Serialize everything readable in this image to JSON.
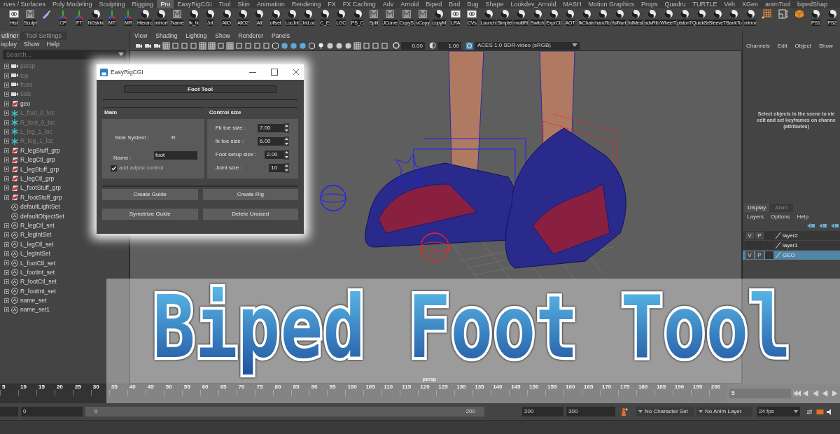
{
  "shelf_tabs": [
    {
      "label": "rves / Surfaces",
      "selected": false
    },
    {
      "label": "Poly Modeling",
      "selected": false
    },
    {
      "label": "Sculpting",
      "selected": false
    },
    {
      "label": "Rigging",
      "selected": false
    },
    {
      "label": "Pro",
      "selected": true
    },
    {
      "label": "EasyRigCGI",
      "selected": false
    },
    {
      "label": "Tool",
      "selected": false
    },
    {
      "label": "Skin",
      "selected": false
    },
    {
      "label": "Animation",
      "selected": false
    },
    {
      "label": "Rendering",
      "selected": false
    },
    {
      "label": "FX",
      "selected": false
    },
    {
      "label": "FX Caching",
      "selected": false
    },
    {
      "label": "Adv",
      "selected": false
    },
    {
      "label": "Arnold",
      "selected": false
    },
    {
      "label": "Biped",
      "selected": false
    },
    {
      "label": "Bird",
      "selected": false
    },
    {
      "label": "Bug",
      "selected": false
    },
    {
      "label": "Shape",
      "selected": false
    },
    {
      "label": "Lookdev_Arnold",
      "selected": false
    },
    {
      "label": "MASH",
      "selected": false
    },
    {
      "label": "Motion Graphics",
      "selected": false
    },
    {
      "label": "Props",
      "selected": false
    },
    {
      "label": "Quadru",
      "selected": false
    },
    {
      "label": "TURTLE",
      "selected": false
    },
    {
      "label": "Veh",
      "selected": false
    },
    {
      "label": "XGen",
      "selected": false
    },
    {
      "label": "animTool",
      "selected": false
    },
    {
      "label": "bipedShap",
      "selected": false
    }
  ],
  "shelf_items": [
    {
      "label": "Hist",
      "kind": "image"
    },
    {
      "label": "Sculpt",
      "kind": "tile"
    },
    {
      "kind": "brush"
    },
    {
      "label": "CP",
      "kind": "axes"
    },
    {
      "label": "FT",
      "kind": "axes"
    },
    {
      "label": "NGskin",
      "kind": "script"
    },
    {
      "label": "MT",
      "kind": "axes"
    },
    {
      "label": "MR",
      "kind": "axes"
    },
    {
      "label": "Hierarc",
      "kind": "script"
    },
    {
      "label": "mirrorI",
      "kind": "script"
    },
    {
      "label": "Name",
      "kind": "tile"
    },
    {
      "label": "fk_Ik",
      "kind": "script"
    },
    {
      "label": "Jnt",
      "kind": "script"
    },
    {
      "label": "AllO",
      "kind": "script"
    },
    {
      "label": "AllO2",
      "kind": "script"
    },
    {
      "label": "All",
      "kind": "script"
    },
    {
      "label": "offset",
      "kind": "script"
    },
    {
      "label": "LocJnt",
      "kind": "script"
    },
    {
      "label": "JntLoc",
      "kind": "script"
    },
    {
      "label": "C_E",
      "kind": "script"
    },
    {
      "label": "LOC",
      "kind": "script"
    },
    {
      "label": "PS_C",
      "kind": "script"
    },
    {
      "label": "Split",
      "kind": "tile"
    },
    {
      "label": "JCurve",
      "kind": "tile"
    },
    {
      "label": "CopyS",
      "kind": "tile"
    },
    {
      "label": "vCopy",
      "kind": "tile"
    },
    {
      "label": "copyM",
      "kind": "script"
    },
    {
      "label": "LRA",
      "kind": "image"
    },
    {
      "label": "CVs",
      "kind": "image"
    },
    {
      "label": "Launch",
      "kind": "script"
    },
    {
      "label": "Simplel",
      "kind": "script"
    },
    {
      "label": "multiRi",
      "kind": "script"
    },
    {
      "label": "Switch",
      "kind": "script"
    },
    {
      "label": "ExprCtl",
      "kind": "script"
    },
    {
      "label": "AOT",
      "kind": "script"
    },
    {
      "label": "fkChain",
      "kind": "script"
    },
    {
      "label": "handTo",
      "kind": "script"
    },
    {
      "label": "folNurt",
      "kind": "script"
    },
    {
      "label": "folMesl",
      "kind": "script"
    },
    {
      "label": "advRib",
      "kind": "script"
    },
    {
      "label": "WheelT",
      "kind": "script"
    },
    {
      "label": "pistonT",
      "kind": "script"
    },
    {
      "label": "QuickSe",
      "kind": "script"
    },
    {
      "label": "SleeveT",
      "kind": "script"
    },
    {
      "label": "BankTo",
      "kind": "script"
    },
    {
      "label": "mirror",
      "kind": "script"
    },
    {
      "kind": "grid"
    },
    {
      "kind": "panel"
    },
    {
      "kind": "cube"
    },
    {
      "label": "PS1",
      "kind": "script"
    },
    {
      "label": "PS2",
      "kind": "script"
    }
  ],
  "outliner": {
    "tabs": [
      {
        "label": "utliner",
        "selected": true
      },
      {
        "label": "Tool Settings",
        "selected": false
      }
    ],
    "menu": [
      "isplay",
      "Show",
      "Help"
    ],
    "search": {
      "placeholder": "Search..."
    },
    "items": [
      {
        "name": "persp",
        "kind": "camera",
        "hidden": true,
        "has_children": true
      },
      {
        "name": "top",
        "kind": "camera",
        "hidden": true,
        "has_children": true
      },
      {
        "name": "front",
        "kind": "camera",
        "hidden": true,
        "has_children": true
      },
      {
        "name": "side",
        "kind": "camera",
        "hidden": true,
        "has_children": true
      },
      {
        "name": "geo",
        "kind": "group",
        "hidden": false,
        "has_children": true
      },
      {
        "name": "L_foot_0_loc",
        "kind": "locator",
        "hidden": true,
        "has_children": true
      },
      {
        "name": "R_foot_0_loc",
        "kind": "locator",
        "hidden": true,
        "has_children": true
      },
      {
        "name": "L_leg_1_loc",
        "kind": "locator",
        "hidden": true,
        "has_children": true
      },
      {
        "name": "R_leg_1_loc",
        "kind": "locator",
        "hidden": true,
        "has_children": true
      },
      {
        "name": "R_legStuff_grp",
        "kind": "group",
        "hidden": false,
        "has_children": true
      },
      {
        "name": "R_legCtl_grp",
        "kind": "group",
        "hidden": false,
        "has_children": true
      },
      {
        "name": "L_legStuff_grp",
        "kind": "group",
        "hidden": false,
        "has_children": true
      },
      {
        "name": "L_legCtl_grp",
        "kind": "group",
        "hidden": false,
        "has_children": true
      },
      {
        "name": "L_footStuff_grp",
        "kind": "group",
        "hidden": false,
        "has_children": true
      },
      {
        "name": "R_footStuff_grp",
        "kind": "group",
        "hidden": false,
        "has_children": true
      },
      {
        "name": "defaultLightSet",
        "kind": "set",
        "hidden": false,
        "has_children": false
      },
      {
        "name": "defaultObjectSet",
        "kind": "set",
        "hidden": false,
        "has_children": false
      },
      {
        "name": "R_legCtl_set",
        "kind": "set",
        "hidden": false,
        "has_children": true
      },
      {
        "name": "R_legIntSet",
        "kind": "set",
        "hidden": false,
        "has_children": true
      },
      {
        "name": "L_legCtl_set",
        "kind": "set",
        "hidden": false,
        "has_children": true
      },
      {
        "name": "L_legIntSet",
        "kind": "set",
        "hidden": false,
        "has_children": true
      },
      {
        "name": "L_footCtl_set",
        "kind": "set",
        "hidden": false,
        "has_children": true
      },
      {
        "name": "L_footInt_set",
        "kind": "set",
        "hidden": false,
        "has_children": true
      },
      {
        "name": "R_footCtl_set",
        "kind": "set",
        "hidden": false,
        "has_children": true
      },
      {
        "name": "R_footInt_set",
        "kind": "set",
        "hidden": false,
        "has_children": true
      },
      {
        "name": "name_set",
        "kind": "set",
        "hidden": false,
        "has_children": true
      },
      {
        "name": "name_set1",
        "kind": "set",
        "hidden": false,
        "has_children": true
      }
    ]
  },
  "viewport": {
    "menu": [
      "View",
      "Shading",
      "Lighting",
      "Show",
      "Renderer",
      "Panels"
    ],
    "exposure": "0.00",
    "gamma": "1.00",
    "color_space": "ACES 1.0 SDR-video (sRGB)",
    "camera_label": "persp"
  },
  "dialog": {
    "title": "EasyRigCGI",
    "header": "Foot Tool",
    "main": {
      "title": "Main",
      "side_label": "Side System :",
      "side_value": "R",
      "name_label": "Name :",
      "name_value": "foot",
      "checkbox": {
        "label": "add adjust control",
        "checked": true
      }
    },
    "control_size": {
      "title": "Control size",
      "fields": [
        {
          "label": "Fk toe size :",
          "value": "7.00"
        },
        {
          "label": "Ik toe size :",
          "value": "6.00"
        },
        {
          "label": "Foot setup size :",
          "value": "2.00"
        },
        {
          "label": "Joint size :",
          "value": "10"
        }
      ]
    },
    "buttons": [
      "Create Guide",
      "Create Rig",
      "Symetrize Guide",
      "Delete Unused"
    ]
  },
  "channel_box": {
    "menu": [
      "Channels",
      "Edit",
      "Object",
      "Show"
    ],
    "message": "Select objects in the scene to vie\nedit and set keyframes on channe\n(attributes)"
  },
  "layer_editor": {
    "tabs": [
      {
        "label": "Display",
        "selected": true
      },
      {
        "label": "Anim",
        "selected": false
      }
    ],
    "menu": [
      "Layers",
      "Options",
      "Help"
    ],
    "layers": [
      {
        "name": "layer2",
        "visible": true,
        "visible_label": "V",
        "playback": true,
        "playback_label": "P",
        "selected": false
      },
      {
        "name": "layer1",
        "visible": false,
        "playback": false,
        "selected": false
      },
      {
        "name": "GEO",
        "visible": true,
        "visible_label": "V",
        "playback": true,
        "playback_label": "P",
        "selected": true
      }
    ]
  },
  "timeline": {
    "ticks": [
      "5",
      "10",
      "15",
      "20",
      "25",
      "30",
      "35",
      "40",
      "45",
      "50",
      "55",
      "60",
      "65",
      "70",
      "75",
      "80",
      "85",
      "90",
      "95",
      "100",
      "105",
      "110",
      "115",
      "120",
      "125",
      "130",
      "135",
      "140",
      "145",
      "150",
      "155",
      "160",
      "165",
      "170",
      "175",
      "180",
      "185",
      "190",
      "195",
      "200"
    ],
    "current_frame": "5"
  },
  "range": {
    "level": 1,
    "start": "0",
    "range_start": "0",
    "range_end": "200",
    "end": "200",
    "anim_end": "300",
    "character_set": "No Character Set",
    "anim_layer": "No Anim Layer",
    "fps": "24 fps"
  },
  "banner": {
    "title": "Biped Foot Tool"
  }
}
